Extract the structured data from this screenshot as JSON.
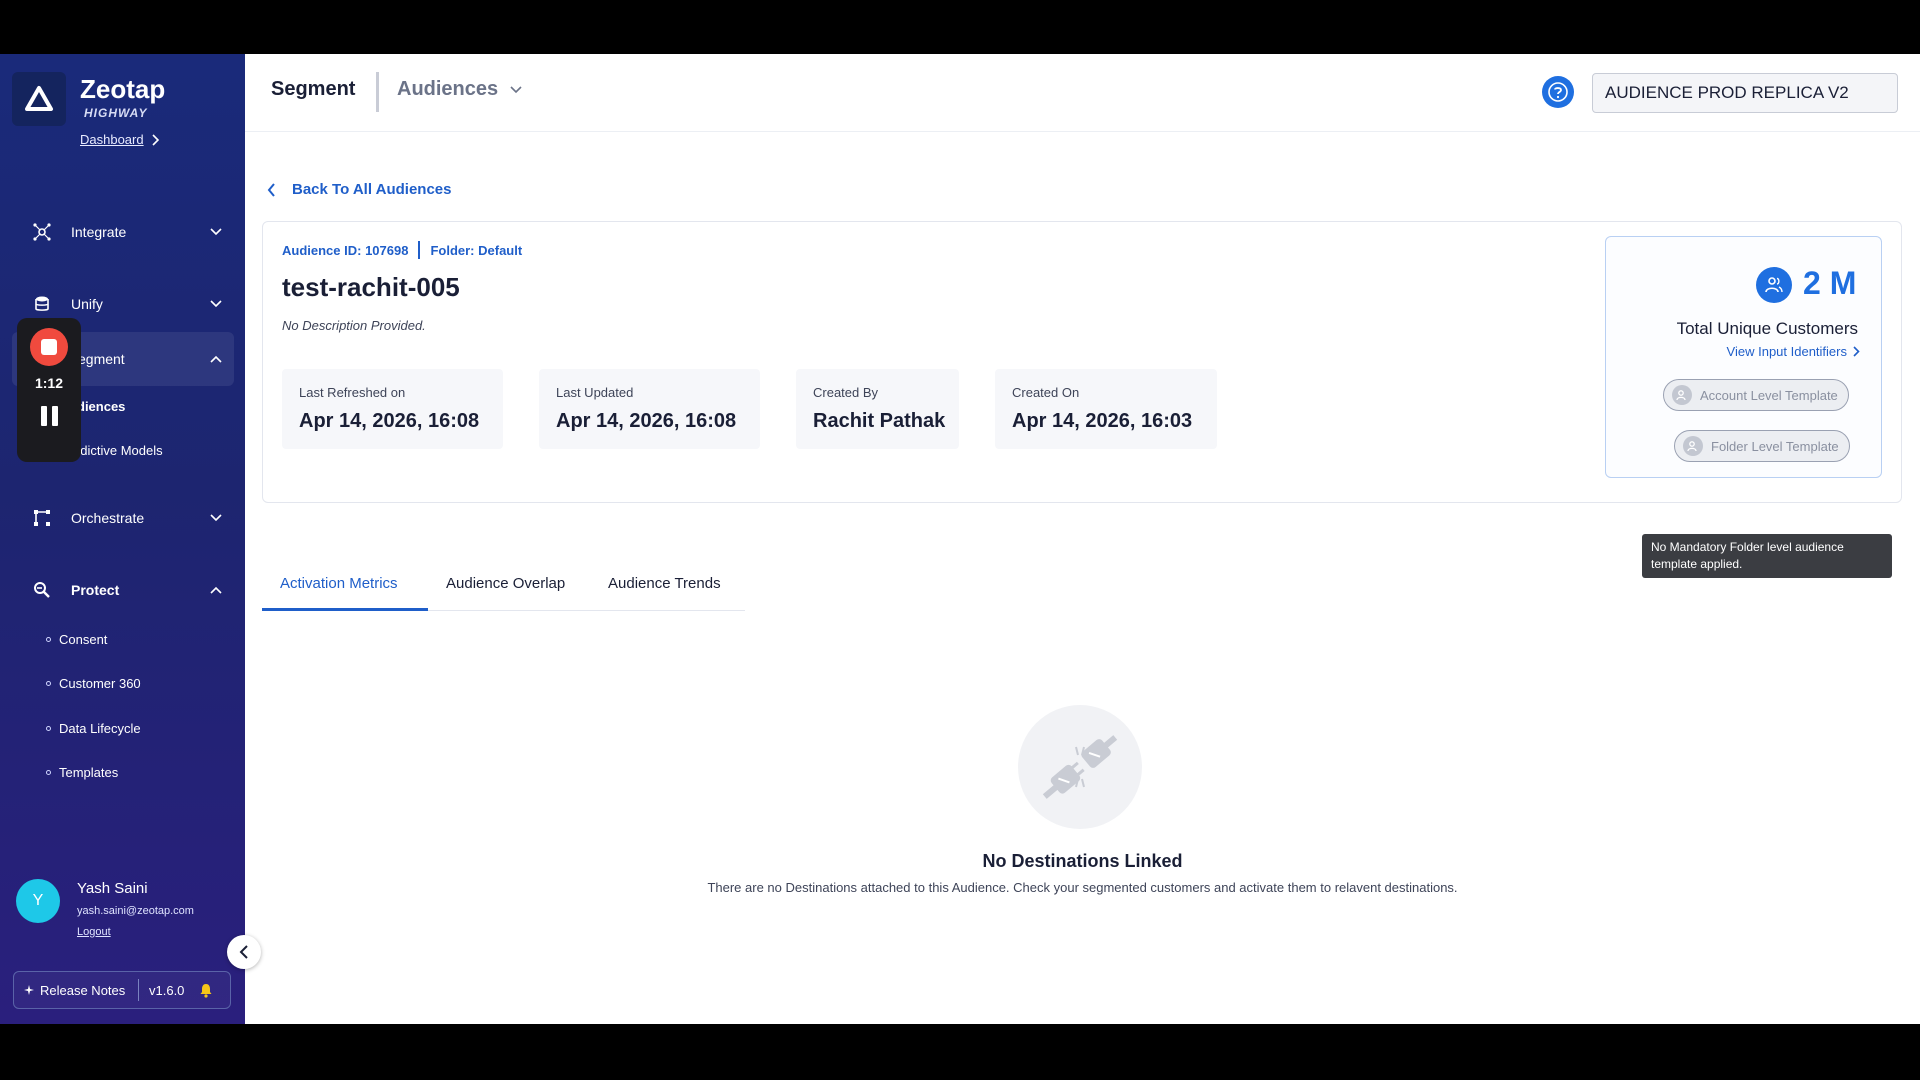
{
  "sidebar": {
    "brand": "Zeotap",
    "brand_sub": "HIGHWAY",
    "dashboard_link": "Dashboard",
    "nav": {
      "integrate": "Integrate",
      "unify": "Unify",
      "segment": "egment",
      "orchestrate": "Orchestrate",
      "protect": "Protect"
    },
    "segment_sub": [
      "diences",
      "edictive Models"
    ],
    "protect_sub": [
      "Consent",
      "Customer 360",
      "Data Lifecycle",
      "Templates"
    ],
    "user": {
      "initial": "Y",
      "name": "Yash Saini",
      "email": "yash.saini@zeotap.com",
      "logout": "Logout"
    },
    "release_notes": "Release Notes",
    "version": "v1.6.0"
  },
  "recorder": {
    "time": "1:12"
  },
  "header": {
    "title": "Segment",
    "section": "Audiences",
    "org_value": "AUDIENCE PROD REPLICA V2"
  },
  "content": {
    "back_label": "Back To All Audiences",
    "audience_id": "Audience ID: 107698",
    "folder": "Folder: Default",
    "name": "test-rachit-005",
    "description": "No Description Provided.",
    "stats": [
      {
        "label": "Last Refreshed on",
        "value": "Apr 14, 2026, 16:08"
      },
      {
        "label": "Last Updated",
        "value": "Apr 14, 2026, 16:08"
      },
      {
        "label": "Created By",
        "value": "Rachit Pathak"
      },
      {
        "label": "Created On",
        "value": "Apr 14, 2026, 16:03"
      }
    ],
    "customers": {
      "value": "2 M",
      "label": "Total Unique Customers",
      "link": "View Input Identifiers",
      "account_template": "Account Level Template",
      "folder_template": "Folder Level Template"
    },
    "tooltip": "No Mandatory Folder level audience template applied.",
    "tabs": [
      "Activation Metrics",
      "Audience Overlap",
      "Audience Trends"
    ],
    "empty": {
      "title": "No Destinations Linked",
      "text": "There are no Destinations attached to this Audience. Check your segmented customers and activate them to relavent destinations."
    }
  },
  "colors": {
    "accent": "#1f6fe0",
    "link": "#1f5ec9",
    "sidebar": "#1d2570",
    "record": "#f04a3e"
  }
}
